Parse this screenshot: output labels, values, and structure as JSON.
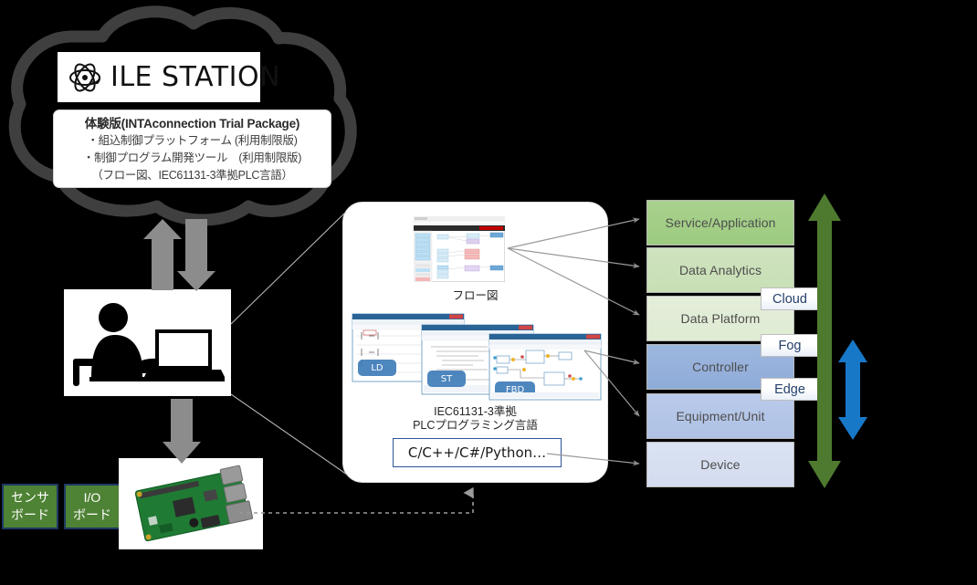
{
  "cloud": {
    "logo": {
      "icon": "atom-icon",
      "text": "ILE STATION"
    },
    "description": {
      "title": "体験版(INTAconnection Trial Package)",
      "line1": "・組込制御プラットフォーム (利用制限版)",
      "line2": "・制御プログラム開発ツール　(利用制限版)",
      "line3": "（フロー図、IEC61131-3準拠PLC言語）"
    }
  },
  "person": {
    "icon": "person-at-laptop-icon"
  },
  "boards": [
    {
      "name": "sensor-board",
      "line1": "センサ",
      "line2": "ボード"
    },
    {
      "name": "io-board",
      "line1": "I/O",
      "line2": "ボード"
    }
  ],
  "device": {
    "icon": "raspberry-pi-board-image"
  },
  "center_panel": {
    "flow": {
      "icon": "flow-editor-screenshot",
      "caption": "フロー図"
    },
    "plc": {
      "icon": "plc-editor-screenshots",
      "windows": [
        {
          "tag": "LD"
        },
        {
          "tag": "ST"
        },
        {
          "tag": "FBD"
        }
      ],
      "caption_line1": "IEC61131-3準拠",
      "caption_line2": "PLCプログラミング言語"
    },
    "code_box": {
      "label": "C/C++/C#/Python…"
    }
  },
  "stack": {
    "layers": [
      {
        "label": "Service/Application",
        "color": "#a9d18e"
      },
      {
        "label": "Data Analytics",
        "color": "#cfe3bf"
      },
      {
        "label": "Data Platform",
        "color": "#e4eeda"
      },
      {
        "label": "Controller",
        "color": "#9db7de"
      },
      {
        "label": "Equipment/Unit",
        "color": "#b9caea"
      },
      {
        "label": "Device",
        "color": "#dae2f2"
      }
    ],
    "badges": [
      {
        "label": "Cloud"
      },
      {
        "label": "Fog"
      },
      {
        "label": "Edge"
      }
    ]
  },
  "arrows": {
    "scope_full": {
      "name": "green-double-arrow",
      "color": "#4e7a2f"
    },
    "scope_edge": {
      "name": "blue-double-arrow",
      "color": "#1878c8"
    },
    "gray": {
      "color": "#808080"
    }
  }
}
